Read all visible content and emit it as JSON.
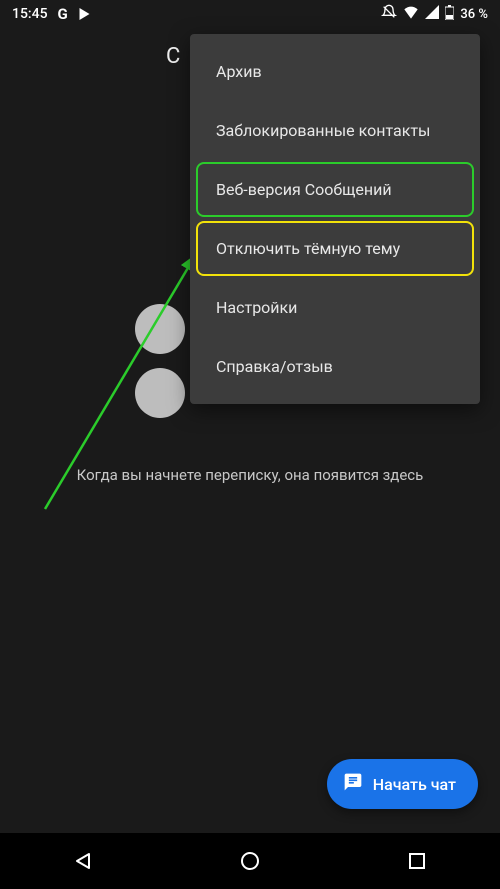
{
  "status": {
    "time": "15:45",
    "battery_text": "36 %"
  },
  "header": {
    "title_visible": "С"
  },
  "menu": {
    "items": [
      {
        "label": "Архив",
        "highlight": ""
      },
      {
        "label": "Заблокированные контакты",
        "highlight": ""
      },
      {
        "label": "Веб-версия Сообщений",
        "highlight": "green"
      },
      {
        "label": "Отключить тёмную тему",
        "highlight": "yellow"
      },
      {
        "label": "Настройки",
        "highlight": ""
      },
      {
        "label": "Справка/отзыв",
        "highlight": ""
      }
    ]
  },
  "empty_state": {
    "text": "Когда вы начнете переписку, она появится здесь"
  },
  "fab": {
    "label": "Начать чат"
  },
  "colors": {
    "highlight_green": "#2bcc2b",
    "highlight_yellow": "#f2e20a",
    "fab_bg": "#1a73e8"
  }
}
